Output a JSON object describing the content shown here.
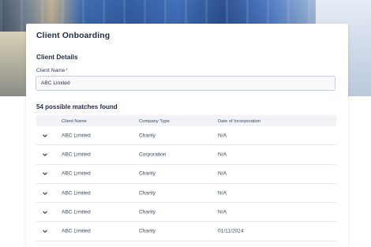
{
  "page": {
    "title": "Client Onboarding",
    "section_title": "Client Details"
  },
  "client_name_field": {
    "label": "Client Name",
    "required_marker": "*",
    "value": "ABC Limited"
  },
  "results": {
    "summary": "54 possible matches found",
    "columns": [
      "Client Name",
      "Company Type",
      "Date of Incorporation"
    ],
    "rows": [
      {
        "name": "ABC Limited",
        "type": "Charity",
        "date": "N/A"
      },
      {
        "name": "ABC Limited",
        "type": "Corporation",
        "date": "N/A"
      },
      {
        "name": "ABC Limited",
        "type": "Charity",
        "date": "N/A"
      },
      {
        "name": "ABC Limited",
        "type": "Charity",
        "date": "N/A"
      },
      {
        "name": "ABC Limited",
        "type": "Charity",
        "date": "N/A"
      },
      {
        "name": "ABC Limited",
        "type": "Charity",
        "date": "01/11/2024"
      }
    ]
  },
  "icons": {
    "row_expand": "chevron-down-icon"
  },
  "colors": {
    "required": "#d0342c",
    "text": "#26324b",
    "header_bg": "#f1f3f6"
  }
}
